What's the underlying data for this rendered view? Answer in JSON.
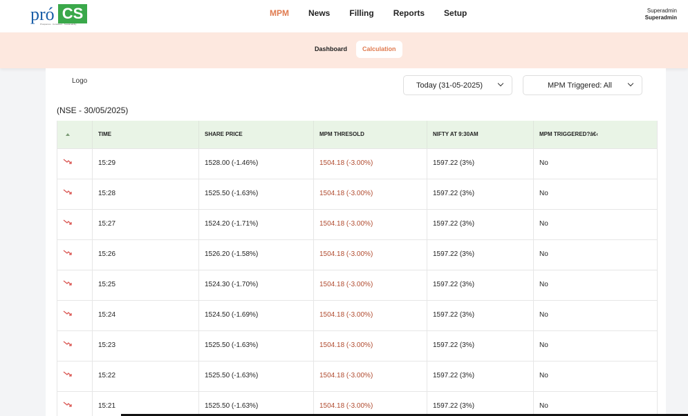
{
  "brand": {
    "pro": "pró",
    "cs": "CS",
    "tagline": "Prosperous · Consistent · Sustainability"
  },
  "nav": {
    "items": [
      "MPM",
      "News",
      "Filling",
      "Reports",
      "Setup"
    ],
    "active": "MPM"
  },
  "user": {
    "name": "Superadmin",
    "role": "Superadmin"
  },
  "subnav": {
    "items": [
      "Dashboard",
      "Calculation"
    ],
    "active": "Calculation"
  },
  "content": {
    "logo_alt": "Logo",
    "date_filter": "Today (31-05-2025)",
    "trigger_filter": "MPM Triggered: All",
    "section_title": "(NSE - 30/05/2025)"
  },
  "table": {
    "headers": [
      "",
      "TIME",
      "SHARE PRICE",
      "MPM THRESOLD",
      "NIFTY AT 9:30AM",
      "MPM TRIGGERED?â€‹"
    ],
    "rows": [
      {
        "time": "15:29",
        "price": "1528.00 (-1.46%)",
        "threshold": "1504.18 (-3.00%)",
        "nifty": "1597.22 (3%)",
        "triggered": "No"
      },
      {
        "time": "15:28",
        "price": "1525.50 (-1.63%)",
        "threshold": "1504.18 (-3.00%)",
        "nifty": "1597.22 (3%)",
        "triggered": "No"
      },
      {
        "time": "15:27",
        "price": "1524.20 (-1.71%)",
        "threshold": "1504.18 (-3.00%)",
        "nifty": "1597.22 (3%)",
        "triggered": "No"
      },
      {
        "time": "15:26",
        "price": "1526.20 (-1.58%)",
        "threshold": "1504.18 (-3.00%)",
        "nifty": "1597.22 (3%)",
        "triggered": "No"
      },
      {
        "time": "15:25",
        "price": "1524.30 (-1.70%)",
        "threshold": "1504.18 (-3.00%)",
        "nifty": "1597.22 (3%)",
        "triggered": "No"
      },
      {
        "time": "15:24",
        "price": "1524.50 (-1.69%)",
        "threshold": "1504.18 (-3.00%)",
        "nifty": "1597.22 (3%)",
        "triggered": "No"
      },
      {
        "time": "15:23",
        "price": "1525.50 (-1.63%)",
        "threshold": "1504.18 (-3.00%)",
        "nifty": "1597.22 (3%)",
        "triggered": "No"
      },
      {
        "time": "15:22",
        "price": "1525.50 (-1.63%)",
        "threshold": "1504.18 (-3.00%)",
        "nifty": "1597.22 (3%)",
        "triggered": "No"
      },
      {
        "time": "15:21",
        "price": "1525.50 (-1.63%)",
        "threshold": "1504.18 (-3.00%)",
        "nifty": "1597.22 (3%)",
        "triggered": "No"
      }
    ]
  },
  "colors": {
    "accent": "#e07b50",
    "threshold": "#b04a2e",
    "header_bg": "#e9f4e6",
    "subbar_bg": "#fde8df",
    "trend_down": "#d9534f"
  },
  "icons": {
    "row_trend": "trend-down-icon",
    "sort": "sort-up-icon"
  }
}
